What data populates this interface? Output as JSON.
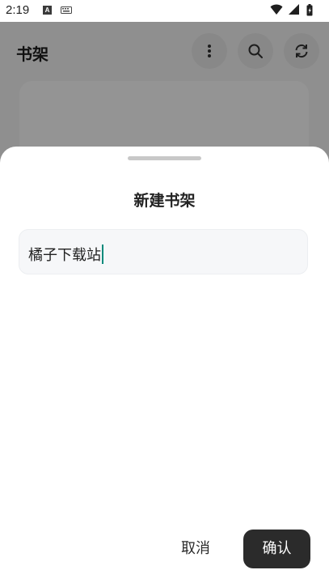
{
  "status_bar": {
    "time": "2:19",
    "icons": [
      "a-notification-icon",
      "keyboard-icon",
      "wifi-icon",
      "signal-icon",
      "battery-icon"
    ]
  },
  "app": {
    "title": "书架",
    "actions": [
      "more-vert-icon",
      "search-icon",
      "refresh-icon"
    ]
  },
  "dialog": {
    "title": "新建书架",
    "input_value": "橘子下载站",
    "cancel_label": "取消",
    "confirm_label": "确认"
  },
  "colors": {
    "confirm_bg": "#2b2b2b",
    "caret": "#00897b",
    "input_bg": "#f6f7f9"
  }
}
